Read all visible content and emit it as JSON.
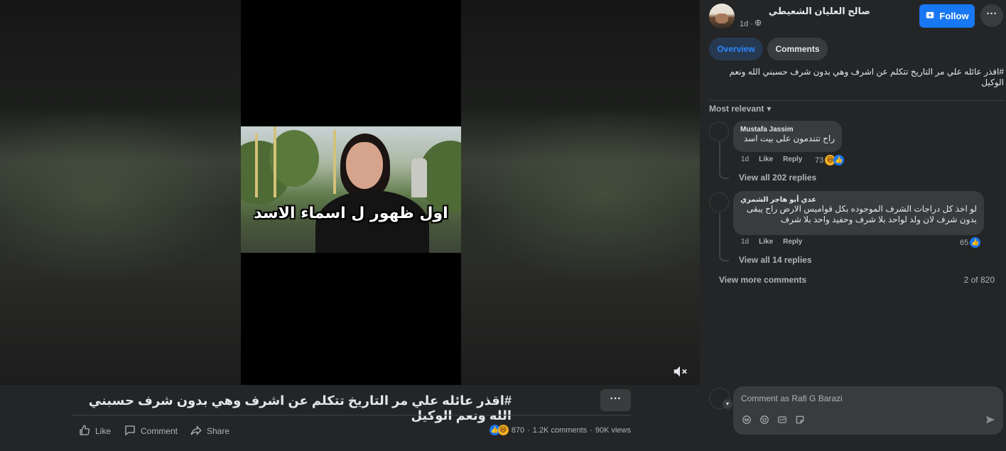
{
  "video": {
    "caption_overlay": "اول ظهور ل اسماء الاسد"
  },
  "post": {
    "title": "#اقذر عائله علي مر التاريخ تتكلم عن اشرف وهي بدون شرف حسبني الله ونعم الوكيل",
    "more_label": "···",
    "actions": {
      "like": "Like",
      "comment": "Comment",
      "share": "Share"
    },
    "stats": {
      "reactions": "870",
      "comments": "1.2K comments",
      "views": "90K views"
    }
  },
  "panel": {
    "author": "صالح العليان الشعيطي",
    "time": "1d ·",
    "follow_label": "Follow",
    "more_label": "···",
    "tabs": {
      "overview": "Overview",
      "comments": "Comments"
    },
    "description": "#اقذر عائله علي مر التاريخ تتكلم عن اشرف وهي بدون شرف حسبني الله ونعم الوكيل",
    "sort_label": "Most relevant",
    "comments": [
      {
        "name": "Mustafa Jassim",
        "text": "راح تتندمون على بيت اسد",
        "time": "1d",
        "like": "Like",
        "reply": "Reply",
        "reactions": "73",
        "view_replies": "View all 202 replies"
      },
      {
        "name": "عدي أبو هاجر الشمري",
        "text": "لو اخذ كل دراجات الشرف الموجوده بكل قواميس الارض راح يبقى بدون شرف لان ولد لواحد بلا شرف وحفيد واحد بلا شرف",
        "time": "1d",
        "like": "Like",
        "reply": "Reply",
        "reactions": "65",
        "view_replies": "View all 14 replies"
      }
    ],
    "view_more": "View more comments",
    "count": "2 of 820",
    "composer_placeholder": "Comment as Rafi G Barazi"
  }
}
